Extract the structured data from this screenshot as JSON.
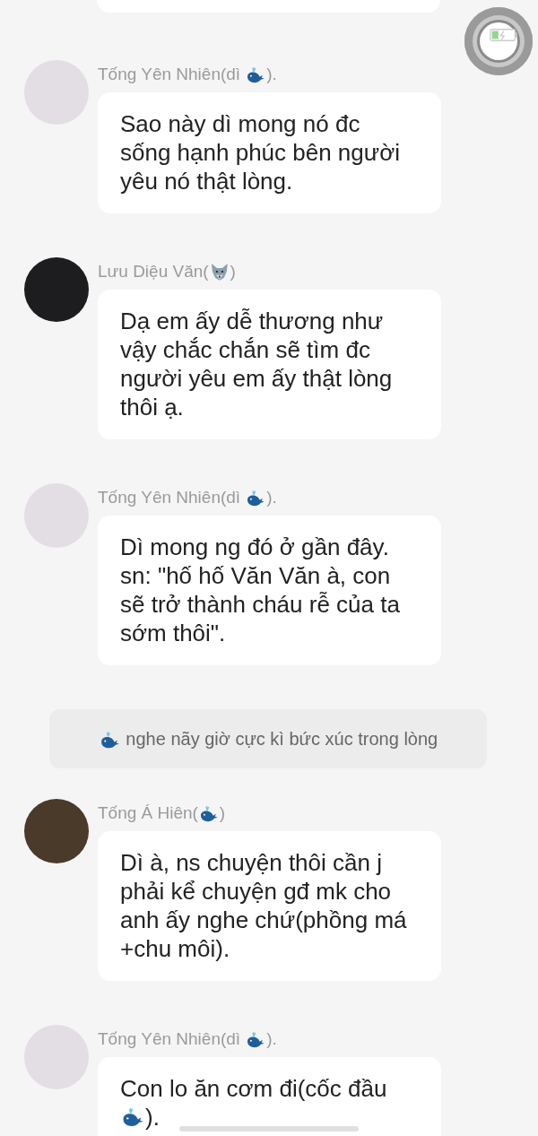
{
  "partial_bubble_above": true,
  "items": [
    {
      "kind": "message",
      "sender": [
        {
          "kind": "text",
          "text": "Tống Yên Nhiên(dì "
        },
        {
          "kind": "whale"
        },
        {
          "kind": "text",
          "text": ")."
        }
      ],
      "color": "#e3dde4",
      "body": [
        {
          "kind": "text",
          "text": "Sao này dì mong nó đc sống hạnh phúc bên người yêu nó thật lòng."
        }
      ]
    },
    {
      "kind": "message",
      "sender": [
        {
          "kind": "text",
          "text": "Lưu Diệu Văn("
        },
        {
          "kind": "wolf"
        },
        {
          "kind": "text",
          "text": ")"
        }
      ],
      "color": "#1d1d1f",
      "body": [
        {
          "kind": "text",
          "text": "Dạ em ấy dễ thương như vậy chắc chắn sẽ tìm đc người yêu em ấy thật lòng thôi ạ."
        }
      ]
    },
    {
      "kind": "message",
      "sender": [
        {
          "kind": "text",
          "text": "Tống Yên Nhiên(dì "
        },
        {
          "kind": "whale"
        },
        {
          "kind": "text",
          "text": ")."
        }
      ],
      "color": "#e3dde4",
      "body": [
        {
          "kind": "text",
          "text": "Dì mong ng đó ở gần đây. sn: \"hố hố Văn Văn à, con sẽ trở thành cháu rễ của ta sớm thôi\"."
        }
      ]
    },
    {
      "kind": "notice",
      "body": [
        {
          "kind": "whale"
        },
        {
          "kind": "text",
          "text": " nghe nãy giờ cực kì bức xúc trong lòng"
        }
      ]
    },
    {
      "kind": "message",
      "sender": [
        {
          "kind": "text",
          "text": "Tống Á Hiên("
        },
        {
          "kind": "whale"
        },
        {
          "kind": "text",
          "text": ")"
        }
      ],
      "color": "#4a3a2a",
      "body": [
        {
          "kind": "text",
          "text": "Dì à, ns chuyện thôi cần j phải kể chuyện gđ mk cho anh ấy nghe chứ(phồng má +chu môi)."
        }
      ]
    },
    {
      "kind": "message",
      "sender": [
        {
          "kind": "text",
          "text": "Tống Yên Nhiên(dì "
        },
        {
          "kind": "whale"
        },
        {
          "kind": "text",
          "text": ")."
        }
      ],
      "color": "#e3dde4",
      "body": [
        {
          "kind": "text",
          "text": "Con lo ăn cơm đi(cốc đầu "
        },
        {
          "kind": "whale"
        },
        {
          "kind": "text",
          "text": ")."
        }
      ]
    }
  ]
}
